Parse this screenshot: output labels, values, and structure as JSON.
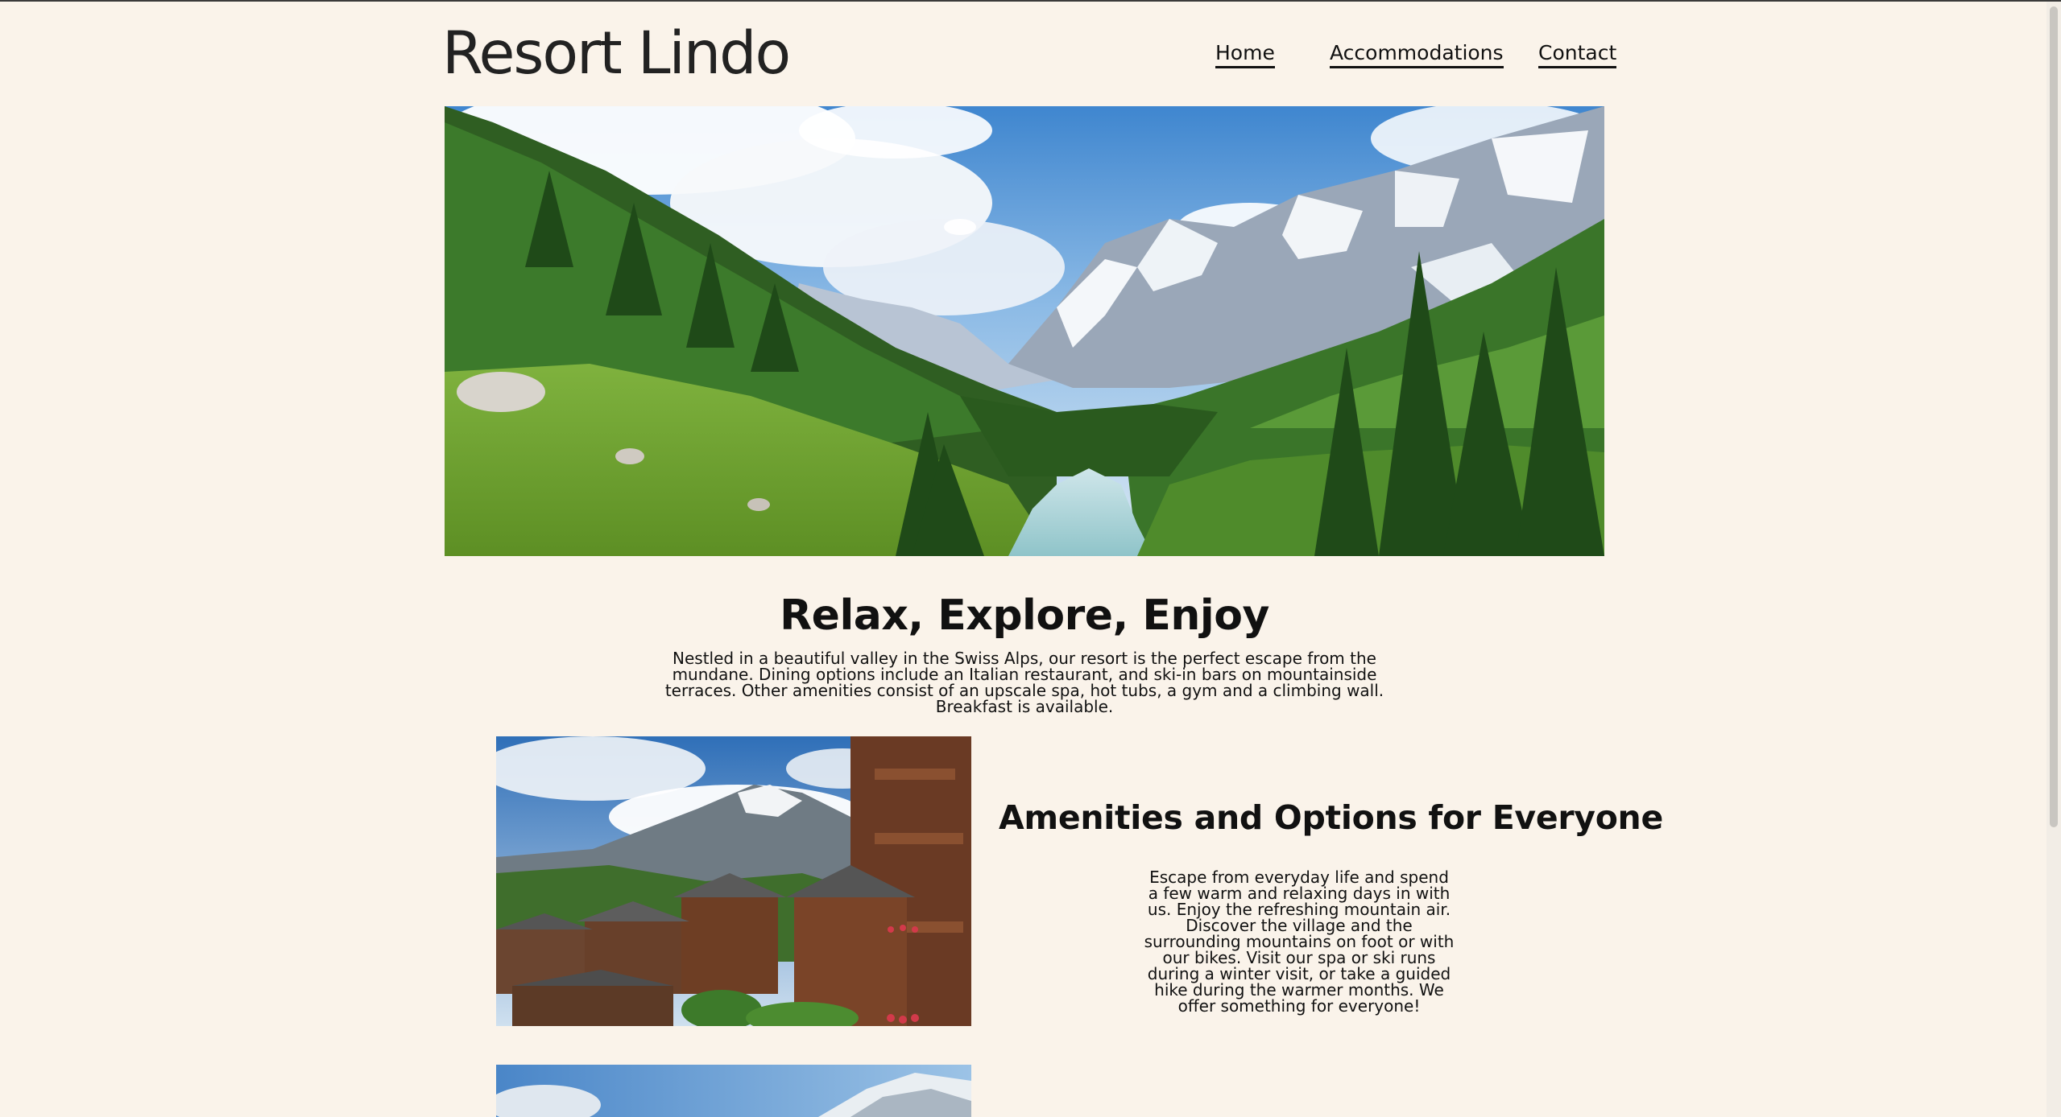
{
  "site": {
    "title": "Resort Lindo"
  },
  "nav": {
    "home": "Home",
    "accommodations": "Accommodations",
    "contact": "Contact"
  },
  "hero": {
    "image": "alpine-valley-photo"
  },
  "intro": {
    "heading": "Relax, Explore, Enjoy",
    "body": "Nestled in a beautiful valley in the Swiss Alps, our resort is the perfect escape from the mundane. Dining options include an Italian restaurant, and ski-in bars on mountainside terraces. Other amenities consist of an upscale spa, hot tubs, a gym and a climbing wall. Breakfast is available."
  },
  "amenities": {
    "image": "alpine-village-chalets-photo",
    "heading": "Amenities and Options for Everyone",
    "body": "Escape from everyday life and spend a few warm and relaxing days in with us. Enjoy the refreshing mountain air. Discover the village and the surrounding mountains on foot or with our bikes. Visit our spa or ski runs during a winter visit, or take a guided hike during the warmer months. We offer something for everyone!"
  },
  "next_section": {
    "image": "snowy-mountain-photo"
  },
  "colors": {
    "background": "#faf3ea",
    "text": "#111111",
    "title": "#222222"
  }
}
